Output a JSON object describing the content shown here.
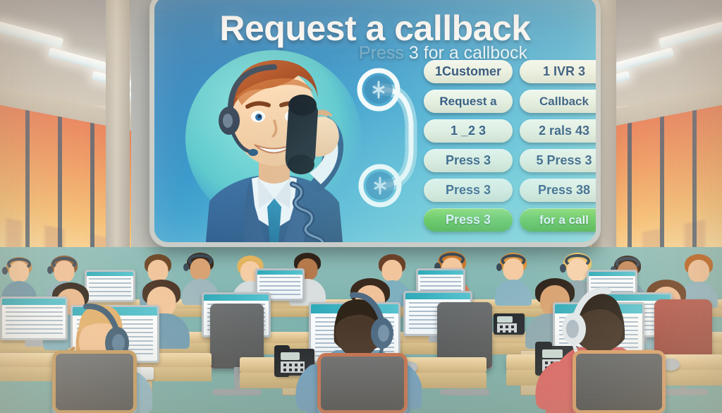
{
  "billboard": {
    "title": "Request a callback",
    "subtitle_faded": "Press",
    "subtitle": "3 for a callbock",
    "accent_blue": "#2e85c0",
    "accent_teal": "#6ec9d8",
    "accent_green": "#5cc532",
    "pill_cream": "#f4f3e0",
    "pill_text": "#1d3f6b"
  },
  "menu_buttons": [
    {
      "label": "1Customer",
      "style": "cream"
    },
    {
      "label": "1 IVR 3",
      "style": "cream"
    },
    {
      "label": "Request a",
      "style": "cream"
    },
    {
      "label": "Callback",
      "style": "cream"
    },
    {
      "label": "1 _2  3",
      "style": "cream"
    },
    {
      "label": "2 rals 43",
      "style": "cream"
    },
    {
      "label": "Press 3",
      "style": "cream"
    },
    {
      "label": "5 Press 3",
      "style": "cream"
    },
    {
      "label": "Press 3",
      "style": "cream"
    },
    {
      "label": "Press 38",
      "style": "cream"
    },
    {
      "label": "Press 3",
      "style": "green"
    },
    {
      "label": "for a call",
      "style": "green"
    }
  ],
  "illustration": {
    "agent_icon": "call-center-agent-with-headset",
    "handset_icon": "telephone-handset-icon",
    "cord_icon": "coiled-phone-cord",
    "glow_icon": "teal-glow-circle"
  },
  "office": {
    "ceiling_icon": "ceiling-strip-light",
    "window_icon": "office-window-sunset",
    "floor_color": "#7fb3ae",
    "desk_color": "#e3c894",
    "screen_header_color": "#2fa9b8",
    "agent_count": 16,
    "workstations": [
      {
        "id": "ws-front-left",
        "agent": "agent-ponytail-blue-shirt",
        "has_phone": false,
        "has_keyboard": true,
        "has_mouse": false
      },
      {
        "id": "ws-front-center",
        "agent": "agent-short-hair-blue-shirt",
        "has_phone": true,
        "has_keyboard": false,
        "has_mouse": true
      },
      {
        "id": "ws-front-right",
        "agent": "agent-red-shirt",
        "has_phone": true,
        "has_keyboard": false,
        "has_mouse": true
      }
    ]
  }
}
